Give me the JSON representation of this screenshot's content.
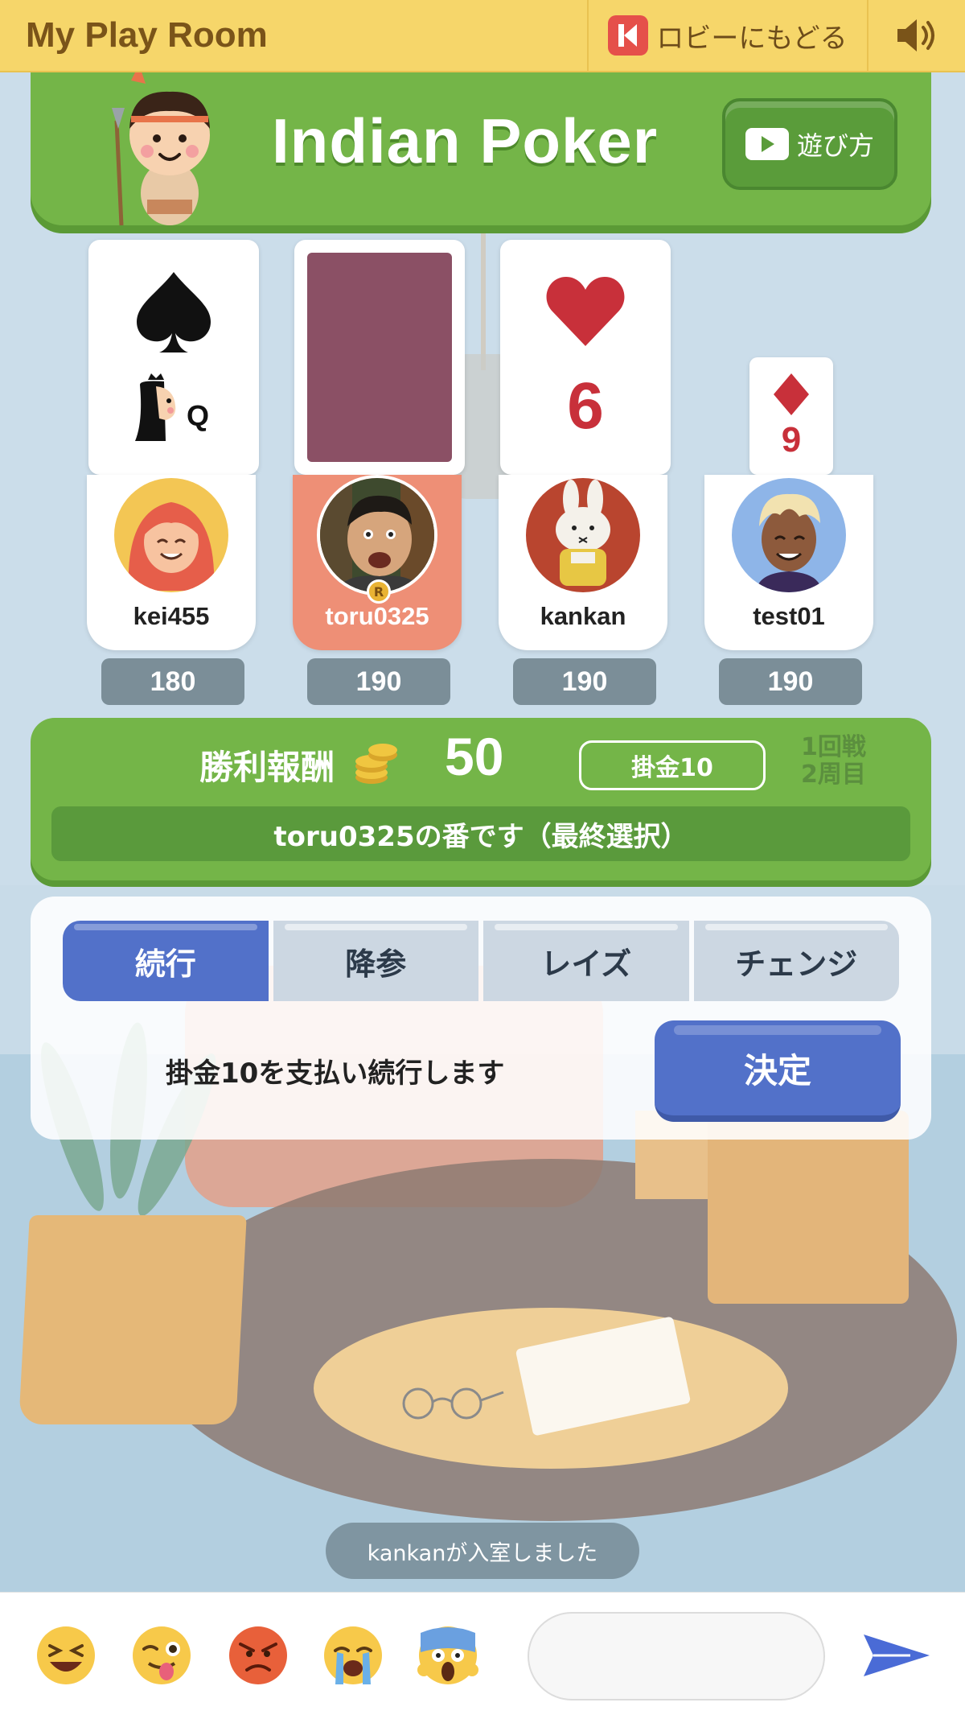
{
  "header": {
    "title": "My Play Room",
    "lobby_label": "ロビーにもどる",
    "sound_icon": "speaker-icon"
  },
  "banner": {
    "game_title": "Indian Poker",
    "howto_label": "遊び方"
  },
  "cards": [
    {
      "suit": "spade",
      "rank": "Q",
      "face": "up"
    },
    {
      "suit": "",
      "rank": "",
      "face": "down"
    },
    {
      "suit": "heart",
      "rank": "6",
      "face": "up"
    },
    {
      "suit": "diamond",
      "rank": "9",
      "face": "up"
    }
  ],
  "players": [
    {
      "name": "kei455",
      "score": "180",
      "active": false
    },
    {
      "name": "toru0325",
      "score": "190",
      "active": true,
      "badge": "R"
    },
    {
      "name": "kankan",
      "score": "190",
      "active": false
    },
    {
      "name": "test01",
      "score": "190",
      "active": false
    }
  ],
  "reward": {
    "label": "勝利報酬",
    "amount": "50",
    "bet_label": "掛金10",
    "round_line1": "1回戦",
    "round_line2": "2周目",
    "turn_text": "toru0325の番です（最終選択）"
  },
  "actions": {
    "tabs": [
      "続行",
      "降参",
      "レイズ",
      "チェンジ"
    ],
    "selected_tab": "続行",
    "description": "掛金10を支払い続行します",
    "confirm_label": "決定"
  },
  "notification": "kankanが入室しました",
  "footer": {
    "emojis": [
      "laughing-emoji",
      "winking-tongue-emoji",
      "angry-emoji",
      "crying-emoji",
      "screaming-emoji"
    ],
    "chat_placeholder": ""
  },
  "colors": {
    "header": "#f6d66a",
    "green_panel": "#74b548",
    "accent_blue": "#5271c9",
    "active_player": "#ee8f76",
    "card_back": "#8b5065",
    "red_suit": "#c8303a"
  }
}
